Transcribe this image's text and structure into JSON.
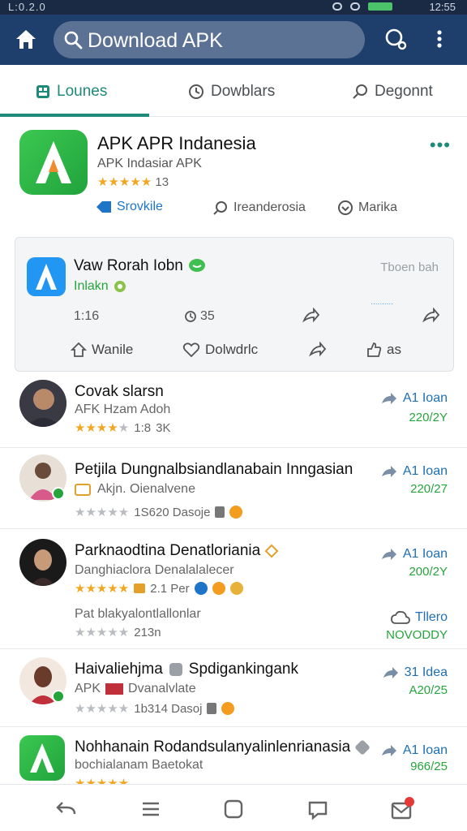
{
  "status": {
    "left": "L:0.2.0",
    "time": "12:55"
  },
  "search": {
    "text": "Download APK"
  },
  "tabs": [
    {
      "label": "Lounes",
      "active": true
    },
    {
      "label": "Dowblars"
    },
    {
      "label": "Degonnt"
    }
  ],
  "featured": {
    "title": "APK APR Indanesia",
    "subtitle": "APK Indasiar APK",
    "rating_stars": 5,
    "rating_count": "13",
    "actions": [
      "Srovkile",
      "Ireanderosia",
      "Marika"
    ]
  },
  "card": {
    "title": "Vaw Rorah Iobn",
    "subtitle": "Inlakn",
    "right_text": "Tboen bah",
    "link_text": "..........",
    "meta": [
      "1:16",
      "35"
    ],
    "actions": [
      "Wanile",
      "Dolwdrlc",
      "as"
    ]
  },
  "list": [
    {
      "name": "Covak slarsn",
      "sub": "AFK Hzam Adoh",
      "stars": 4,
      "rate_text": "3K",
      "rate_prefix": "1:8",
      "btn": "A1 Ioan",
      "date": "220/2Y"
    },
    {
      "name": "Petjila Dungnalbsiandlanabain Inngasian",
      "sub": "Akjn. Oienalvene",
      "stars": 0,
      "rate_text": "1S620 Dasoje",
      "btn": "A1 Ioan",
      "date": "220/27"
    },
    {
      "name": "Parknaodtina Denatloriania",
      "sub": "Danghiaclora Denalalalecer",
      "stars": 5,
      "rate_text": "2.1 Per",
      "btn": "A1 Ioan",
      "date": "200/2Y",
      "extra_title": "Pat blakyalontlallonlar",
      "extra_rate": "213n",
      "extra_btn": "Tllero",
      "extra_date": "NOVODDY"
    },
    {
      "name": "Haivaliehjma",
      "name2": "Spdigankingank",
      "sub": "APK",
      "sub2": "Dvanalvlate",
      "stars": 0,
      "rate_text": "1b314 Dasoj",
      "btn": "31 Idea",
      "date": "A20/25"
    },
    {
      "name": "Nohhanain Rodandsulanyalinlenrianasia",
      "sub": "bochialanam Baetokat",
      "stars": 5,
      "rate_text": "",
      "btn": "A1 Ioan",
      "date": "966/25"
    }
  ],
  "colors": {
    "appbar": "#1e3f6b",
    "accent": "#1e8a7a",
    "link": "#1e75c8",
    "star": "#f1a721",
    "green": "#27a33c"
  }
}
